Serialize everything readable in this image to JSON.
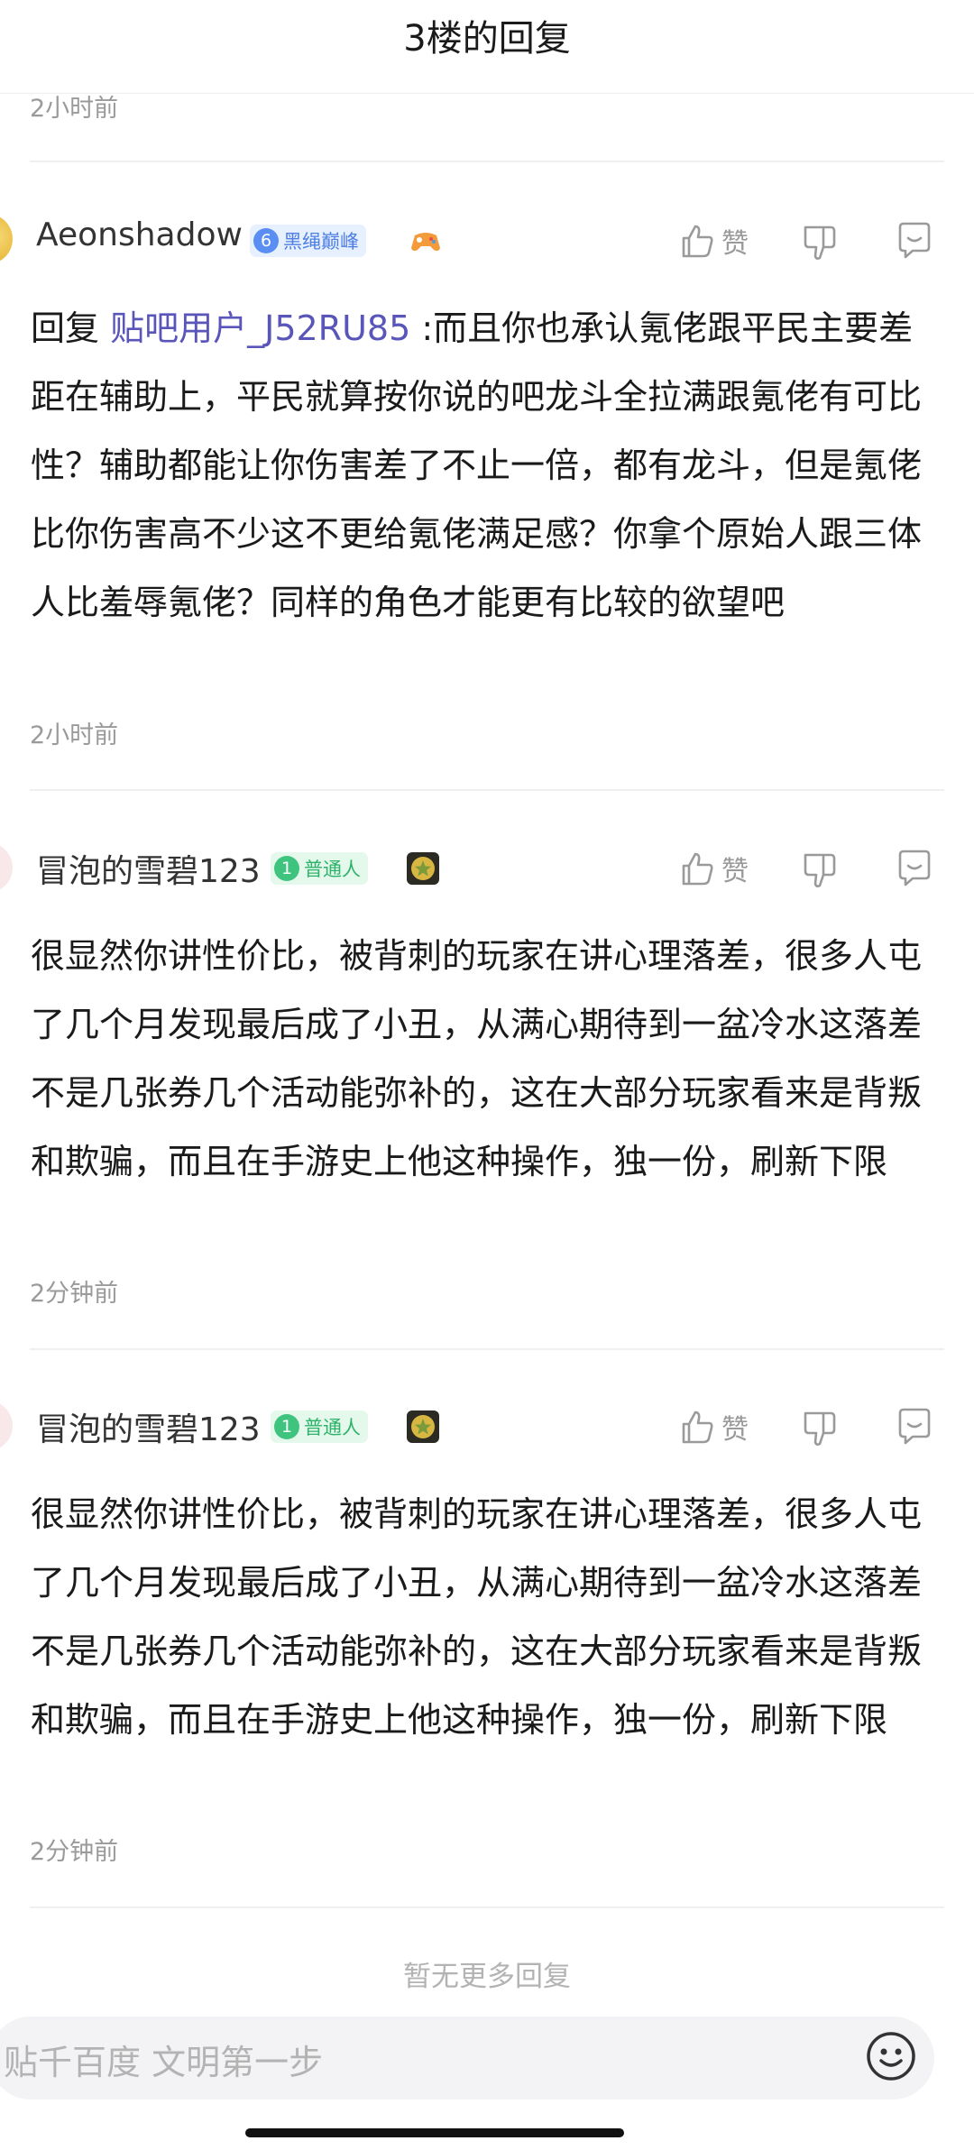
{
  "header": {
    "title": "3楼的回复"
  },
  "prev_time": "2小时前",
  "posts": [
    {
      "username": "Aeonshadow",
      "level": "6",
      "level_title": "黑绳巅峰",
      "medal_icon": "game-controller-icon",
      "like_label": "赞",
      "reply_prefix": "回复",
      "mention": "贴吧用户_J52RU85",
      "content": " :而且你也承认氪佬跟平民主要差距在辅助上，平民就算按你说的吧龙斗全拉满跟氪佬有可比性？辅助都能让你伤害差了不止一倍，都有龙斗，但是氪佬比你伤害高不少这不更给氪佬满足感？你拿个原始人跟三体人比羞辱氪佬？同样的角色才能更有比较的欲望吧",
      "time": "2小时前"
    },
    {
      "username": "冒泡的雪碧123",
      "level": "1",
      "level_title": "普通人",
      "medal_icon": "star-medal-icon",
      "like_label": "赞",
      "content": "很显然你讲性价比，被背刺的玩家在讲心理落差，很多人屯了几个月发现最后成了小丑，从满心期待到一盆冷水这落差不是几张券几个活动能弥补的，这在大部分玩家看来是背叛和欺骗，而且在手游史上他这种操作，独一份，刷新下限",
      "time": "2分钟前"
    },
    {
      "username": "冒泡的雪碧123",
      "level": "1",
      "level_title": "普通人",
      "medal_icon": "star-medal-icon",
      "like_label": "赞",
      "content": "很显然你讲性价比，被背刺的玩家在讲心理落差，很多人屯了几个月发现最后成了小丑，从满心期待到一盆冷水这落差不是几张券几个活动能弥补的，这在大部分玩家看来是背叛和欺骗，而且在手游史上他这种操作，独一份，刷新下限",
      "time": "2分钟前"
    }
  ],
  "footer": {
    "no_more": "暂无更多回复"
  },
  "input": {
    "placeholder": "贴千百度 文明第一步"
  },
  "colors": {
    "mention": "#5a56b9",
    "time": "#9a9a9a",
    "level_blue": "#5b8ef3",
    "level_green": "#3ec47e"
  }
}
